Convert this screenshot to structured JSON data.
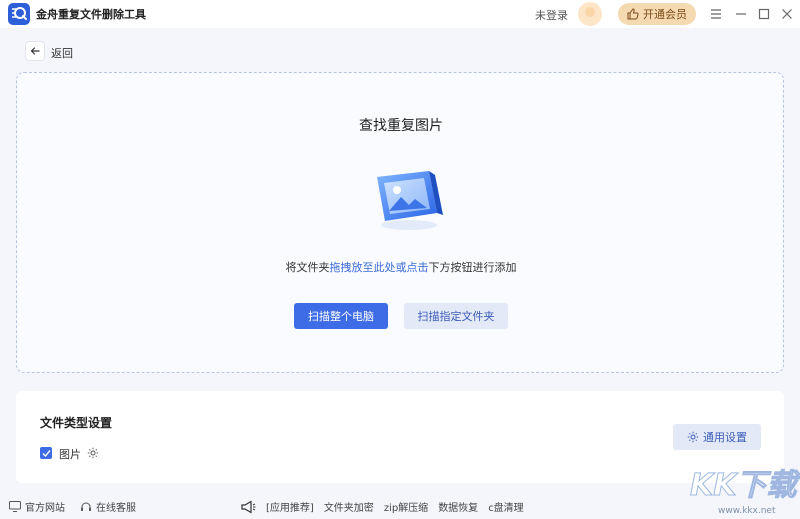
{
  "app": {
    "title": "金舟重复文件删除工具",
    "login_text": "未登录",
    "vip_label": "开通会员"
  },
  "nav": {
    "back_label": "返回"
  },
  "drop_zone": {
    "title": "查找重复图片",
    "hint_prefix": "将文件夹",
    "hint_highlight": "拖拽放至此处或点击",
    "hint_suffix": "下方按钮进行添加",
    "scan_all_label": "扫描整个电脑",
    "scan_folder_label": "扫描指定文件夹"
  },
  "settings": {
    "title": "文件类型设置",
    "image_label": "图片",
    "image_checked": true,
    "general_label": "通用设置"
  },
  "footer": {
    "website": "官方网站",
    "support": "在线客服",
    "app_recommend": "[应用推荐]",
    "links": [
      "文件夹加密",
      "zip解压缩",
      "数据恢复",
      "c盘清理"
    ]
  },
  "watermark": {
    "text": "KK下载",
    "url": "www.kkx.net"
  },
  "colors": {
    "accent": "#3e6ce6",
    "link": "#3a6bd8",
    "vip": "#f5d9b0"
  }
}
